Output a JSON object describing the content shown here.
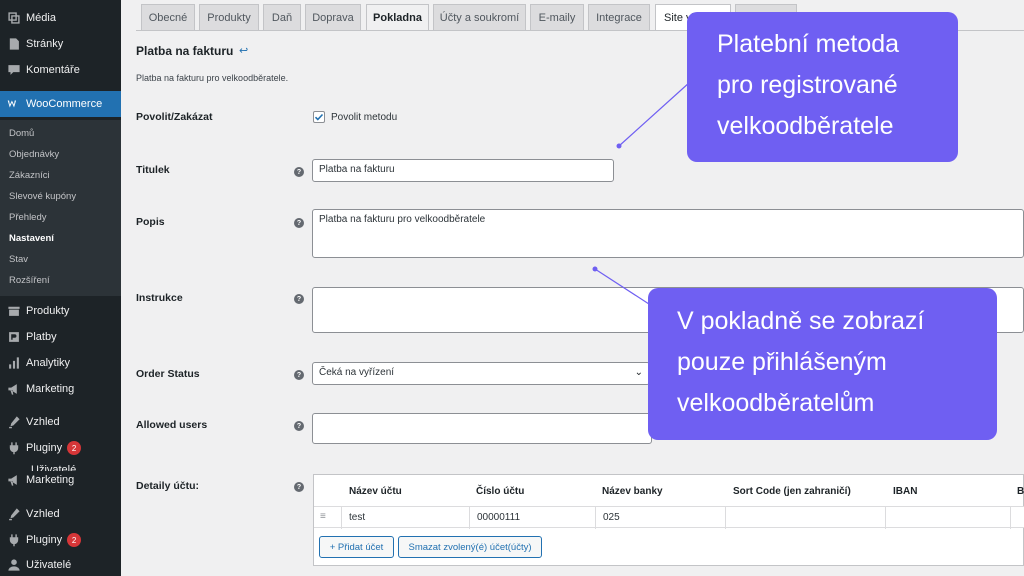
{
  "sidebar": {
    "items_top": [
      {
        "label": "Média",
        "icon": "media-icon"
      },
      {
        "label": "Stránky",
        "icon": "pages-icon"
      },
      {
        "label": "Komentáře",
        "icon": "comments-icon"
      }
    ],
    "woocommerce": {
      "label": "WooCommerce",
      "icon": "woocommerce-icon"
    },
    "submenu": [
      "Domů",
      "Objednávky",
      "Zákazníci",
      "Slevové kupóny",
      "Přehledy",
      "Nastavení",
      "Stav",
      "Rozšíření"
    ],
    "submenu_current": "Nastavení",
    "items_bottom": [
      {
        "label": "Produkty",
        "icon": "products-icon"
      },
      {
        "label": "Platby",
        "icon": "payments-icon"
      },
      {
        "label": "Analytiky",
        "icon": "analytics-icon"
      },
      {
        "label": "Marketing",
        "icon": "marketing-icon"
      },
      {
        "label": "Vzhled",
        "icon": "appearance-icon"
      },
      {
        "label": "Pluginy",
        "icon": "plugins-icon",
        "badge": "2"
      },
      {
        "label": "Uživatelé",
        "icon": "users-icon"
      },
      {
        "label": "Marketing",
        "icon": "marketing-icon"
      },
      {
        "label": "Vzhled",
        "icon": "appearance-icon"
      },
      {
        "label": "Pluginy",
        "icon": "plugins-icon",
        "badge": "2"
      },
      {
        "label": "Uživatelé",
        "icon": "users-icon"
      }
    ]
  },
  "tabs": [
    {
      "label": "Obecné"
    },
    {
      "label": "Produkty"
    },
    {
      "label": "Daň"
    },
    {
      "label": "Doprava"
    },
    {
      "label": "Pokladna"
    },
    {
      "label": "Účty a soukromí"
    },
    {
      "label": "E-maily"
    },
    {
      "label": "Integrace"
    },
    {
      "label": "Site vi"
    },
    {
      "label": ""
    }
  ],
  "page": {
    "title": "Platba na fakturu",
    "title_link_icon": "↩",
    "description": "Platba na fakturu pro velkoodběratele."
  },
  "form": {
    "enable": {
      "label": "Povolit/Zakázat",
      "checkbox_label": "Povolit metodu",
      "checked": true
    },
    "title": {
      "label": "Titulek",
      "value": "Platba na fakturu"
    },
    "description": {
      "label": "Popis",
      "value": "Platba na fakturu pro velkoodběratele"
    },
    "instructions": {
      "label": "Instrukce",
      "value": ""
    },
    "order_status": {
      "label": "Order Status",
      "value": "Čeká na vyřízení"
    },
    "allowed_users": {
      "label": "Allowed users",
      "value": ""
    },
    "account_details": {
      "label": "Detaily účtu:"
    }
  },
  "accounts_table": {
    "headers": [
      "Název účtu",
      "Číslo účtu",
      "Název banky",
      "Sort Code (jen zahraničí)",
      "IBAN",
      "B"
    ],
    "rows": [
      [
        "test",
        "00000111",
        "025",
        "",
        "",
        ""
      ]
    ],
    "add_button": "+ Přidat účet",
    "remove_button": "Smazat zvolený(é) účet(účty)"
  },
  "callouts": [
    {
      "lines": [
        "Platební metoda",
        "pro registrované",
        "velkoodběratele"
      ]
    },
    {
      "lines": [
        "V pokladně se zobrazí",
        "pouze přihlášeným",
        "velkoodběratelům"
      ]
    }
  ],
  "help_icon_glyph": "?",
  "colors": {
    "sidebar_bg": "#1d2327",
    "accent": "#2271b1",
    "callout": "#6f5ff2",
    "badge": "#d63638"
  }
}
